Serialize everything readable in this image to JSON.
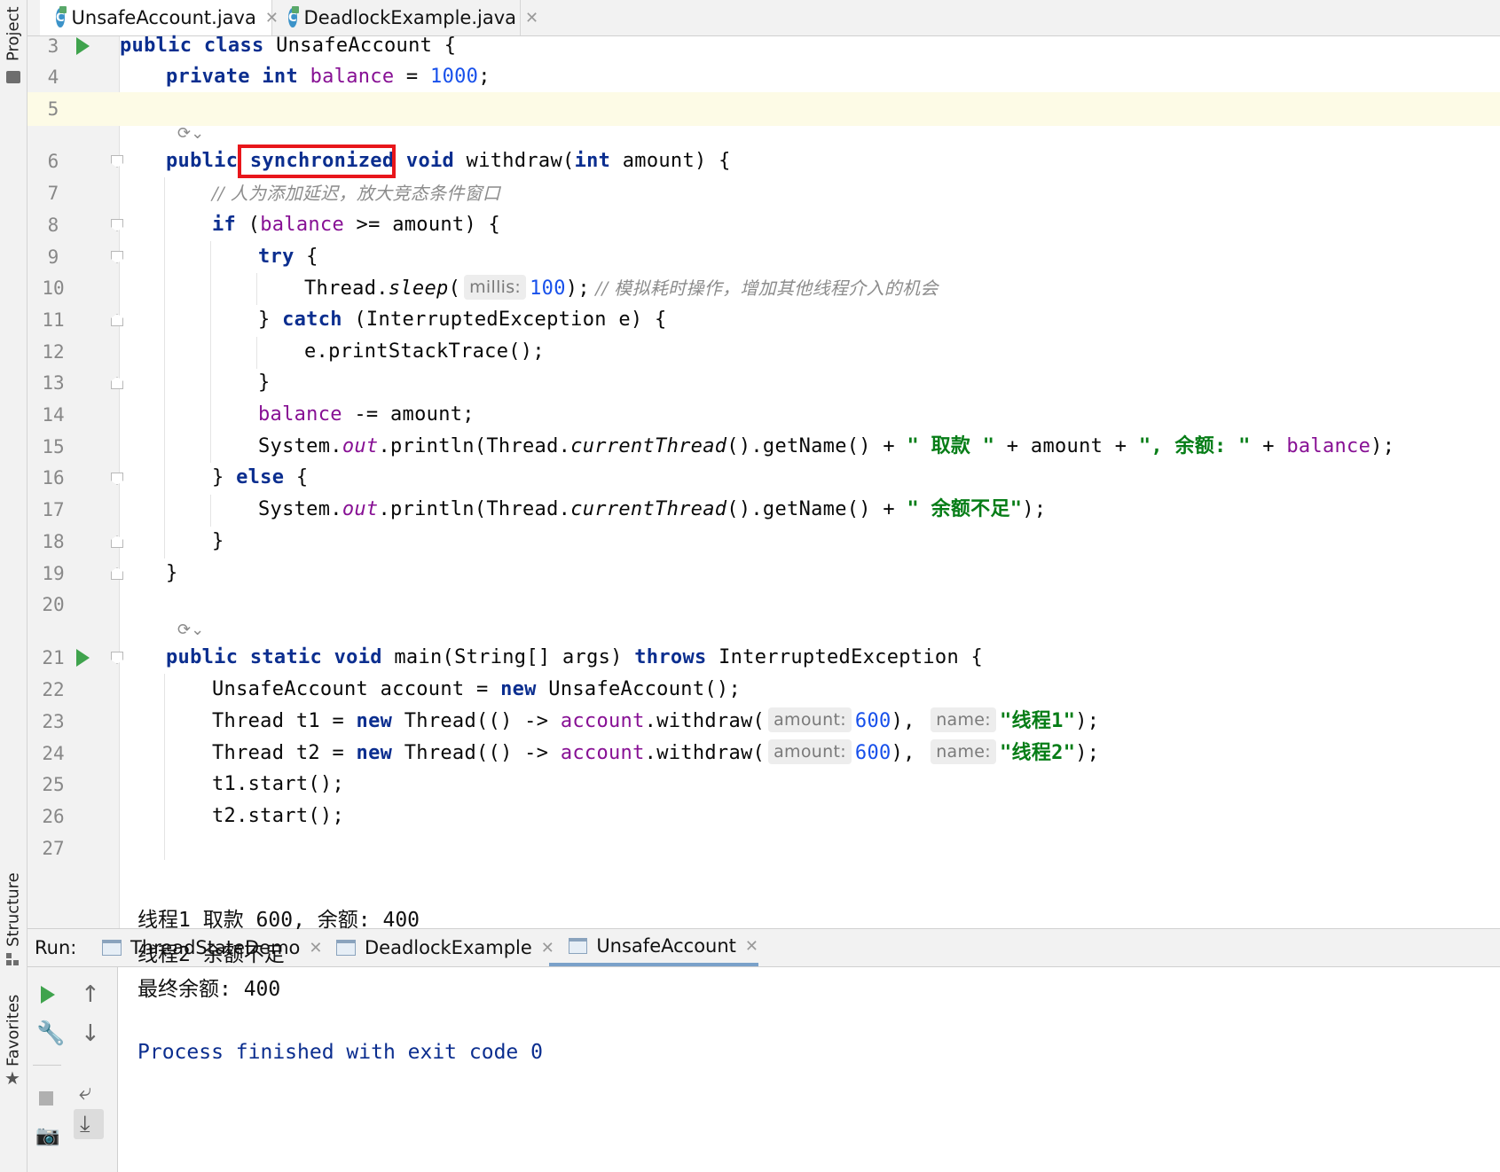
{
  "left_strip": {
    "project": "Project",
    "structure": "Structure",
    "favorites": "Favorites"
  },
  "tabs": [
    {
      "label": "UnsafeAccount.java",
      "active": true
    },
    {
      "label": "DeadlockExample.java",
      "active": false
    }
  ],
  "line_numbers": [
    "3",
    "4",
    "5",
    "6",
    "7",
    "8",
    "9",
    "10",
    "11",
    "12",
    "13",
    "14",
    "15",
    "16",
    "17",
    "18",
    "19",
    "20",
    "21",
    "22",
    "23",
    "24",
    "25",
    "26",
    "27"
  ],
  "code": {
    "l3": {
      "kw": "public class",
      "rest": " UnsafeAccount {"
    },
    "l4": {
      "kw1": "private",
      "kw2": "int",
      "field": "balance",
      "eq": " = ",
      "num": "1000",
      "end": ";"
    },
    "l6": {
      "kw1": "public",
      "sync": "synchronized",
      "kw2": "void",
      "mid": " withdraw(",
      "kw3": "int",
      "end": " amount) {"
    },
    "l7": {
      "comment": "// 人为添加延迟，放大竞态条件窗口"
    },
    "l8": {
      "kw": "if",
      "open": " (",
      "field": "balance",
      "end": " >= amount) {"
    },
    "l9": {
      "kw": "try",
      "end": " {"
    },
    "l10": {
      "pre": "Thread.",
      "method": "sleep",
      "paren": "(",
      "hint": "millis:",
      "num": "100",
      "end": ");",
      "comment": " // 模拟耗时操作，增加其他线程介入的机会"
    },
    "l11": {
      "pre": "} ",
      "kw": "catch",
      "end": " (InterruptedException e) {"
    },
    "l12": {
      "text": "e.printStackTrace();"
    },
    "l13": {
      "text": "}"
    },
    "l14": {
      "field": "balance",
      "end": " -= amount;"
    },
    "l15": {
      "p1": "System.",
      "out": "out",
      "p2": ".println(Thread.",
      "ct": "currentThread",
      "p3": "().getName() + ",
      "s1": "\" 取款 \"",
      "p4": " + amount + ",
      "s2": "\", 余额: \"",
      "p5": " + ",
      "field": "balance",
      "p6": ");"
    },
    "l16": {
      "pre": "} ",
      "kw": "else",
      "end": " {"
    },
    "l17": {
      "p1": "System.",
      "out": "out",
      "p2": ".println(Thread.",
      "ct": "currentThread",
      "p3": "().getName() + ",
      "s1": "\" 余额不足\"",
      "p4": ");"
    },
    "l18": {
      "text": "}"
    },
    "l19": {
      "text": "}"
    },
    "l21": {
      "kw": "public static void",
      "mid": " main(String[] args) ",
      "kw2": "throws",
      "end": " InterruptedException {"
    },
    "l22": {
      "pre": "UnsafeAccount account = ",
      "kw": "new",
      "end": " UnsafeAccount();"
    },
    "l23": {
      "pre": "Thread t1 = ",
      "kw": "new",
      "mid": " Thread(() -> ",
      "fld": "account",
      "mid2": ".withdraw(",
      "hint1": "amount:",
      "num": "600",
      "mid3": "),",
      "hint2": "name:",
      "str": "\"线程1\"",
      "end": ");"
    },
    "l24": {
      "pre": "Thread t2 = ",
      "kw": "new",
      "mid": " Thread(() -> ",
      "fld": "account",
      "mid2": ".withdraw(",
      "hint1": "amount:",
      "num": "600",
      "mid3": "),",
      "hint2": "name:",
      "str": "\"线程2\"",
      "end": ");"
    },
    "l25": {
      "text": "t1.start();"
    },
    "l26": {
      "text": "t2.start();"
    }
  },
  "run": {
    "label": "Run:",
    "tabs": [
      {
        "label": "ThreadStateDemo",
        "active": false
      },
      {
        "label": "DeadlockExample",
        "active": false
      },
      {
        "label": "UnsafeAccount",
        "active": true
      }
    ],
    "output": [
      "线程1 取款 600, 余额: 400",
      "线程2 余额不足",
      "最终余额: 400",
      "",
      "Process finished with exit code 0"
    ]
  },
  "colors": {
    "keyword": "#0b2e8f",
    "field": "#871094",
    "number": "#1750eb",
    "string": "#067d17",
    "highlight_box": "#e8161b",
    "run_green": "#3fa34d"
  }
}
